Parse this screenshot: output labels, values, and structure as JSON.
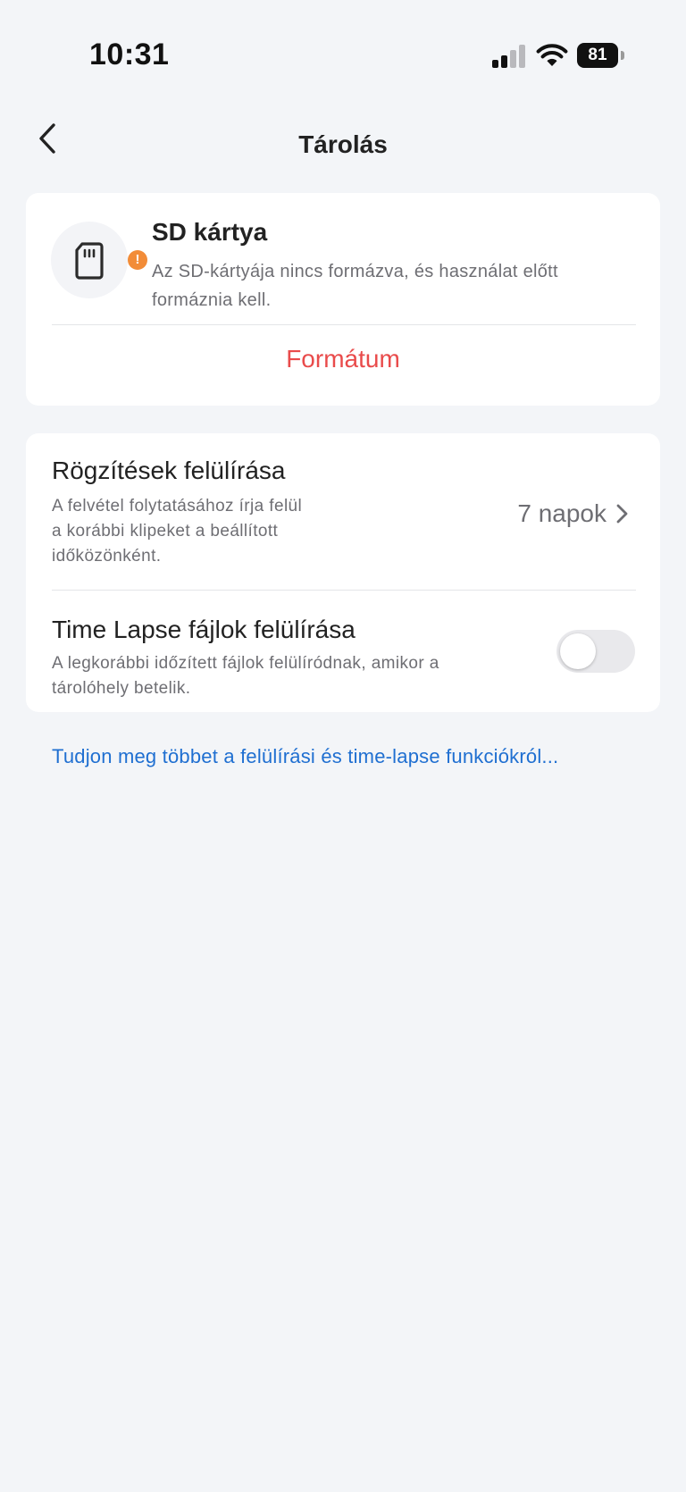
{
  "status_bar": {
    "time": "10:31",
    "battery_level": "81",
    "icons": [
      "signal-icon",
      "wifi-icon",
      "battery-icon"
    ]
  },
  "nav": {
    "title": "Tárolás",
    "back_icon": "chevron-left-icon"
  },
  "sd_card": {
    "icon": "sd-card-icon",
    "warning_icon": "exclamation-icon",
    "warning_mark": "!",
    "warning_color": "#f28c38",
    "title": "SD kártya",
    "description": "Az SD-kártyája nincs formázva, és használat előtt formáznia kell.",
    "format_label": "Formátum",
    "format_color": "#e94b4b"
  },
  "settings": {
    "overwrite_recordings": {
      "title": "Rögzítések felülírása",
      "description_lines": [
        "A felvétel folytatásához írja felül",
        "a korábbi klipeket a beállított",
        "időközönként."
      ],
      "value": "7 napok",
      "chevron_icon": "chevron-right-icon"
    },
    "overwrite_timelapse": {
      "title": "Time Lapse fájlok felülírása",
      "description_lines": [
        "A legkorábbi időzített fájlok felülíródnak, amikor a",
        "tárolóhely betelik."
      ],
      "toggle_on": false
    }
  },
  "learn_more": {
    "label": "Tudjon meg többet a felülírási és time-lapse funkciókról...",
    "color": "#1f6fd1"
  }
}
